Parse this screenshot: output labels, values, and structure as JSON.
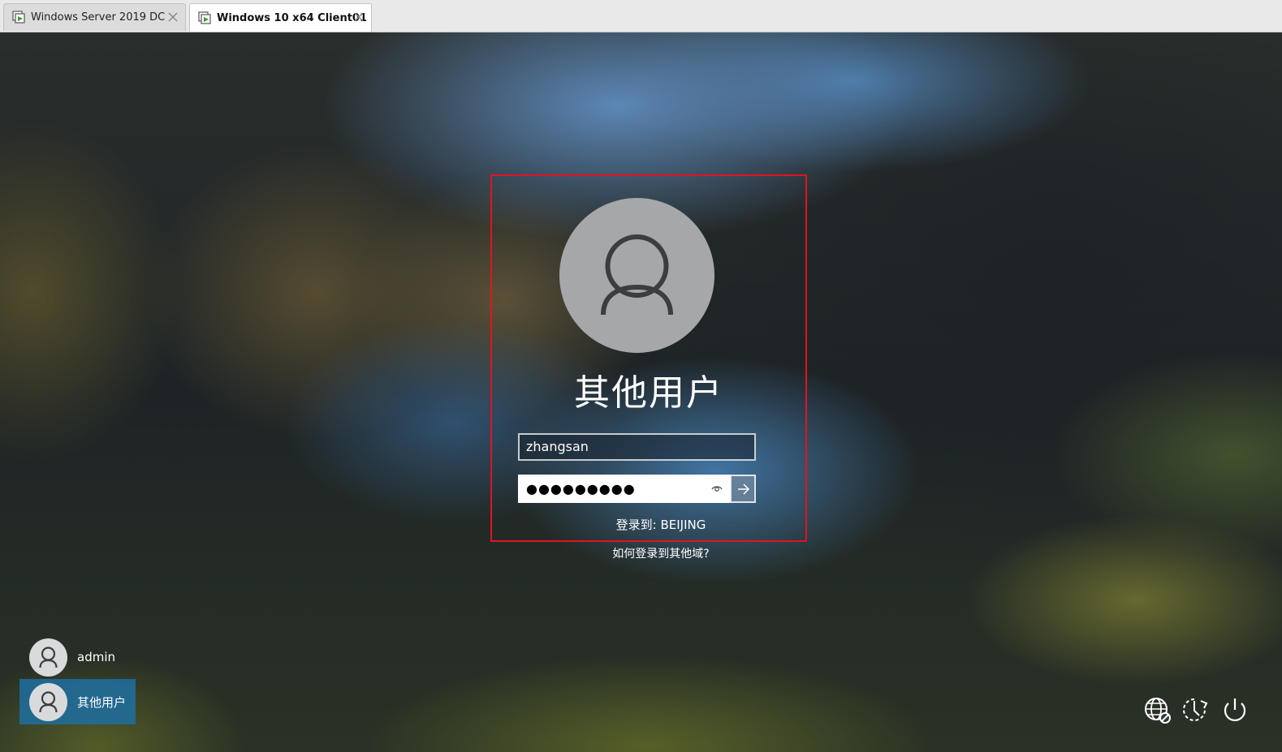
{
  "tabs": [
    {
      "label": "Windows Server 2019 DC",
      "active": false
    },
    {
      "label": "Windows 10 x64 Client01",
      "active": true
    }
  ],
  "login": {
    "user_title": "其他用户",
    "username_value": "zhangsan",
    "password_mask": "●●●●●●●●●",
    "signin_to": "登录到: BEIJING",
    "other_domain_link": "如何登录到其他域?"
  },
  "users": [
    {
      "name": "admin",
      "selected": false
    },
    {
      "name": "其他用户",
      "selected": true
    }
  ],
  "system_icons": [
    "network-icon",
    "accessibility-icon",
    "power-icon"
  ],
  "colors": {
    "highlight_border": "#e0141e",
    "selected_user_bg": "#1e6ea0",
    "avatar_bg": "#a5a7a9"
  }
}
